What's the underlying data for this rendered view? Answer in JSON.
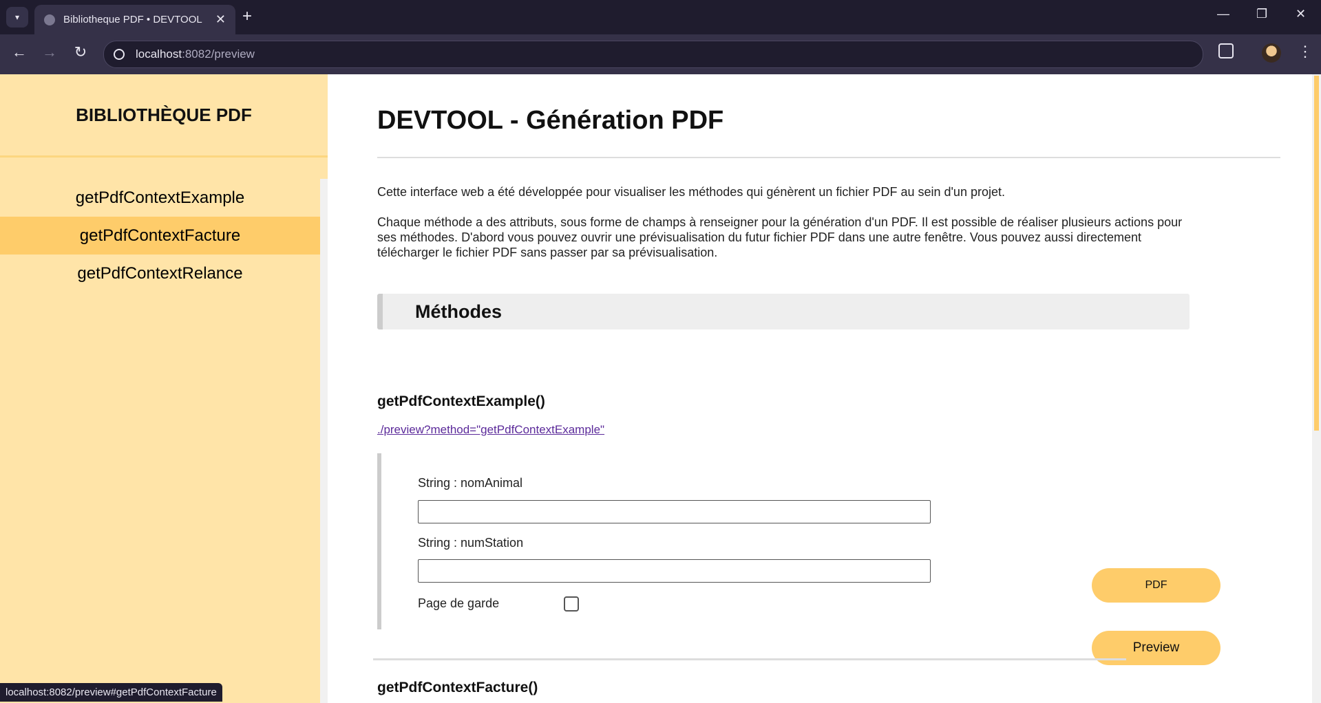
{
  "browser": {
    "tab_title": "Bibliotheque PDF • DEVTOOL",
    "url_host": "localhost",
    "url_path": ":8082/preview",
    "status_url": "localhost:8082/preview#getPdfContextFacture",
    "icons": {
      "tab_menu": "▾",
      "close": "✕",
      "new_tab": "+",
      "minimize": "—",
      "restore": "❐",
      "window_close": "✕",
      "back": "←",
      "forward": "→",
      "reload": "↻",
      "menu": "⋮"
    }
  },
  "sidebar": {
    "title": "BIBLIOTHÈQUE PDF",
    "items": [
      {
        "label": "getPdfContextExample"
      },
      {
        "label": "getPdfContextFacture"
      },
      {
        "label": "getPdfContextRelance"
      }
    ]
  },
  "main": {
    "title": "DEVTOOL - Génération PDF",
    "intro_1": "Cette interface web a été développée pour visualiser les méthodes qui génèrent un fichier PDF au sein d'un projet.",
    "intro_2": "Chaque méthode a des attributs, sous forme de champs à renseigner pour la génération d'un PDF. Il est possible de réaliser plusieurs actions pour ses méthodes. D'abord vous pouvez ouvrir une prévisualisation du futur fichier PDF dans une autre fenêtre. Vous pouvez aussi directement télécharger le fichier PDF sans passer par sa prévisualisation.",
    "section_title": "Méthodes",
    "methods": [
      {
        "name": "getPdfContextExample()",
        "link": "./preview?method=\"getPdfContextExample\"",
        "fields": [
          {
            "label": "String : nomAnimal",
            "value": ""
          },
          {
            "label": "String : numStation",
            "value": ""
          }
        ],
        "checkbox_label": "Page de garde",
        "checkbox_checked": false,
        "pdf_label": "PDF",
        "preview_label": "Preview"
      },
      {
        "name": "getPdfContextFacture()"
      }
    ]
  },
  "colors": {
    "sidebar_bg": "#ffe4a8",
    "accent": "#fecc6a",
    "link": "#5b2a9a",
    "browser_dark": "#1f1c2e"
  }
}
